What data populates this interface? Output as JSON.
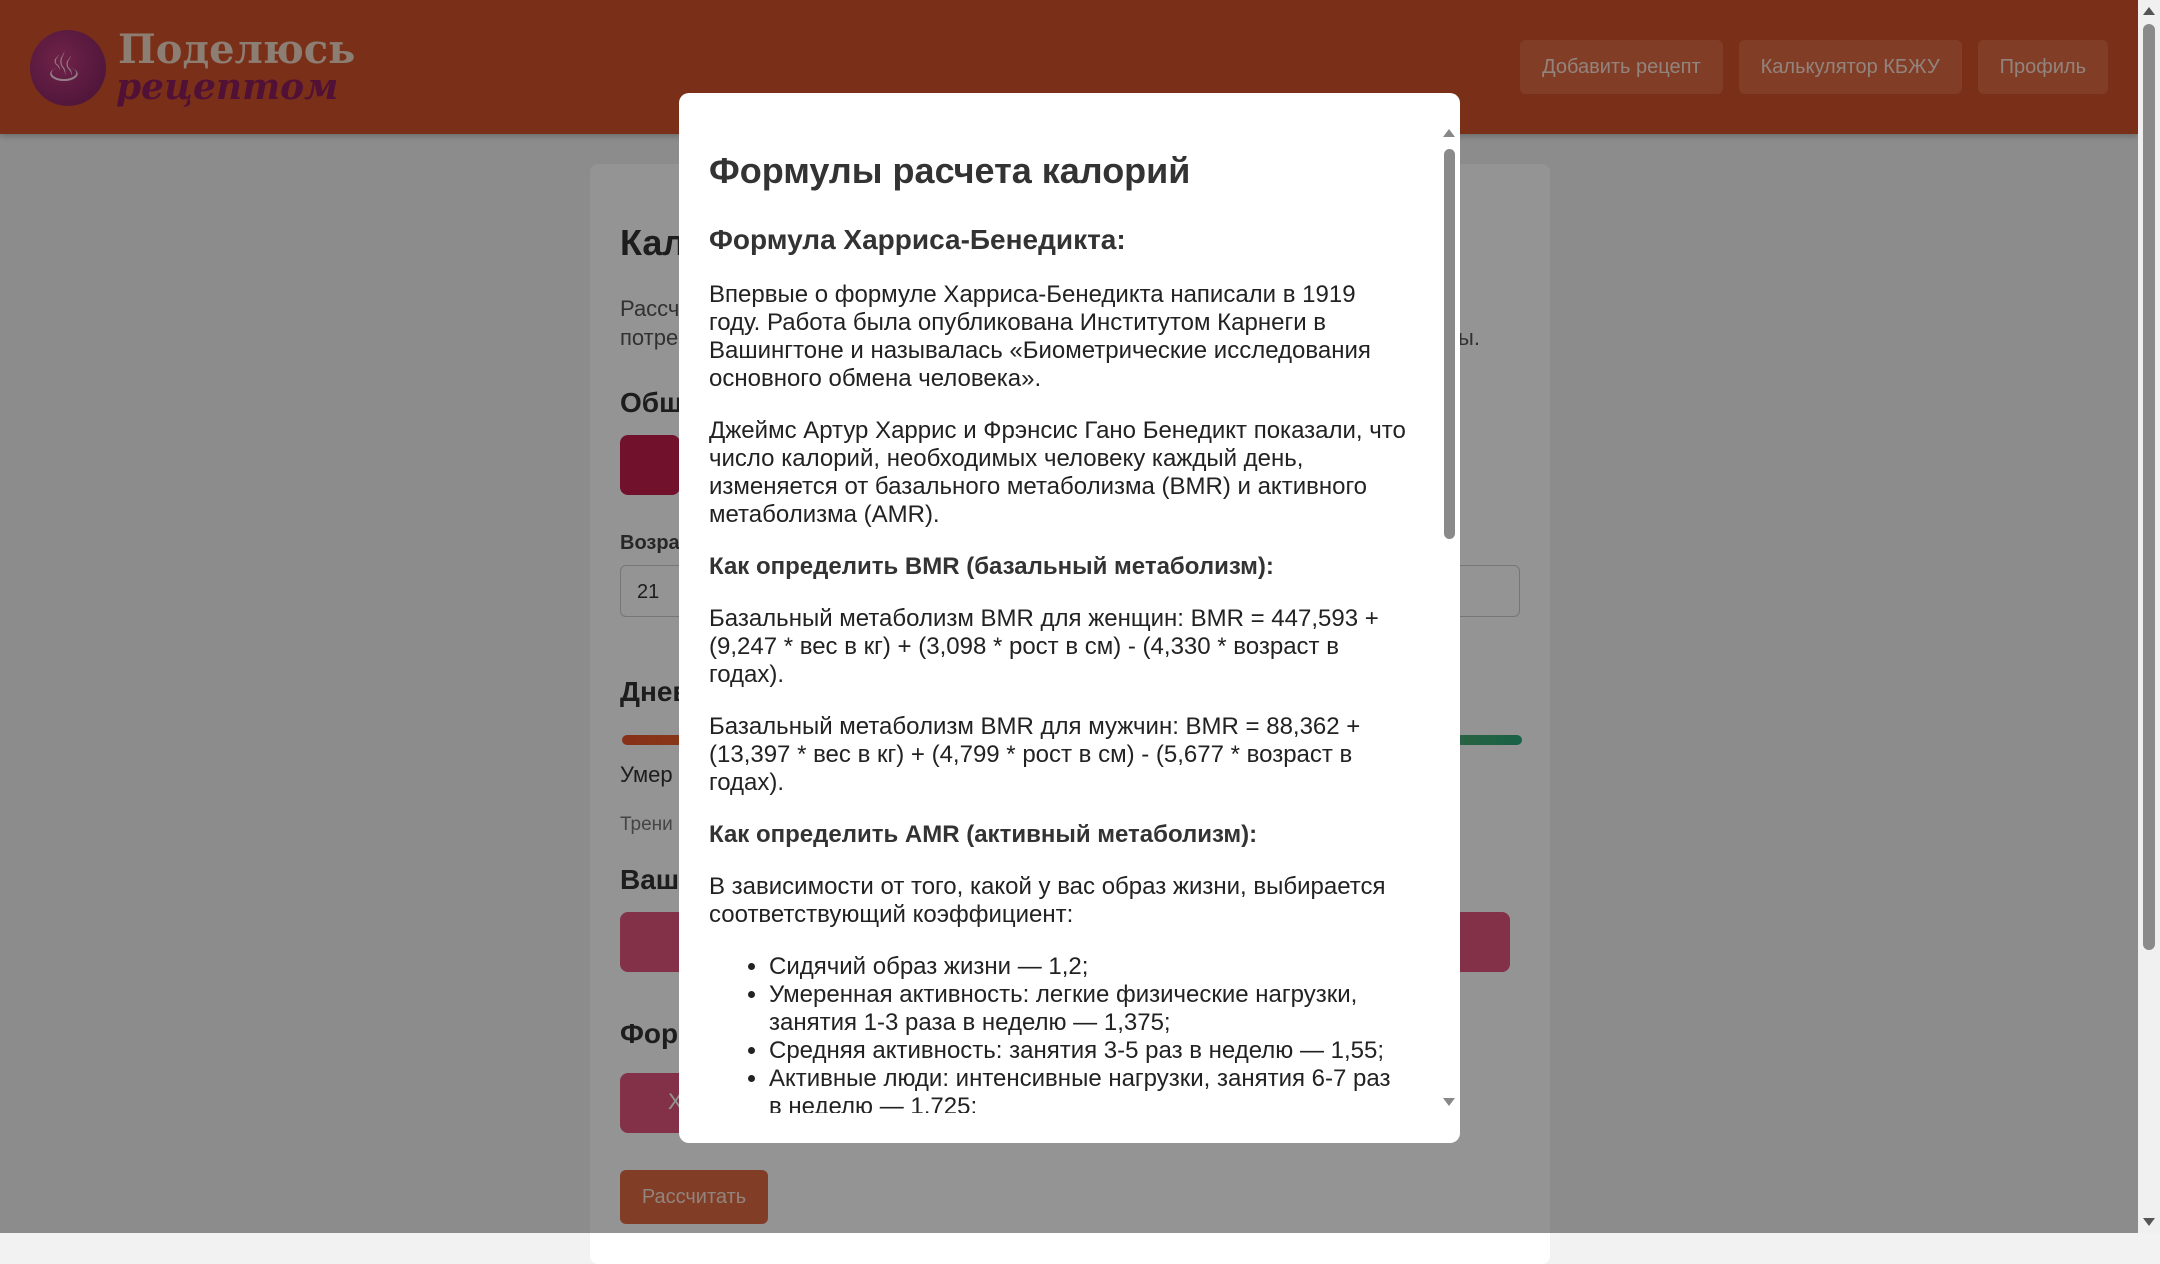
{
  "header": {
    "logo_line1": "Поделюсь",
    "logo_line2": "рецептом",
    "nav": [
      {
        "label": "Добавить рецепт"
      },
      {
        "label": "Калькулятор КБЖУ"
      },
      {
        "label": "Профиль"
      }
    ]
  },
  "page": {
    "heading": "Кал",
    "intro_line1": "Рассч",
    "intro_line2": "потре",
    "intro_tail": "ы.",
    "section_general": "Общ",
    "age_label": "Возра",
    "age_value": "21",
    "section_daily": "Днев",
    "activity_value": "Умер",
    "activity_hint": "Трени",
    "section_goal": "Ваш",
    "section_formula": "Фор",
    "formula_btn_letter": "Х",
    "calculate_button": "Рассчитать"
  },
  "modal": {
    "title": "Формулы расчета калорий",
    "section1_title": "Формула Харриса-Бенедикта:",
    "p1": "Впервые о формуле Харриса-Бенедикта написали в 1919 году. Работа была опубликована Институтом Карнеги в Вашингтоне и называлась «Биометрические исследования основного обмена человека».",
    "p2": "Джеймс Артур Харрис и Фрэнсис Гано Бенедикт показали, что число калорий, необходимых человеку каждый день, изменяется от базального метаболизма (BMR) и активного метаболизма (AMR).",
    "bmr_heading": "Как определить BMR (базальный метаболизм):",
    "bmr_women": "Базальный метаболизм BMR для женщин: BMR = 447,593 + (9,247 * вес в кг) + (3,098 * рост в см) - (4,330 * возраст в годах).",
    "bmr_men": "Базальный метаболизм BMR для мужчин: BMR = 88,362 + (13,397 * вес в кг) + (4,799 * рост в см) - (5,677 * возраст в годах).",
    "amr_heading": "Как определить AMR (активный метаболизм):",
    "amr_intro": "В зависимости от того, какой у вас образ жизни, выбирается соответствующий коэффициент:",
    "amr_items": [
      "Сидячий образ жизни — 1,2;",
      "Умеренная активность: легкие физические нагрузки, занятия 1-3 раза в неделю — 1,375;",
      "Средняя активность: занятия 3-5 раз в неделю — 1,55;",
      "Активные люди: интенсивные нагрузки, занятия 6-7 раз в неделю — 1,725;"
    ]
  },
  "colors": {
    "header": "#d2532a",
    "accent_button": "#e06a42",
    "pink": "#e0557d"
  }
}
